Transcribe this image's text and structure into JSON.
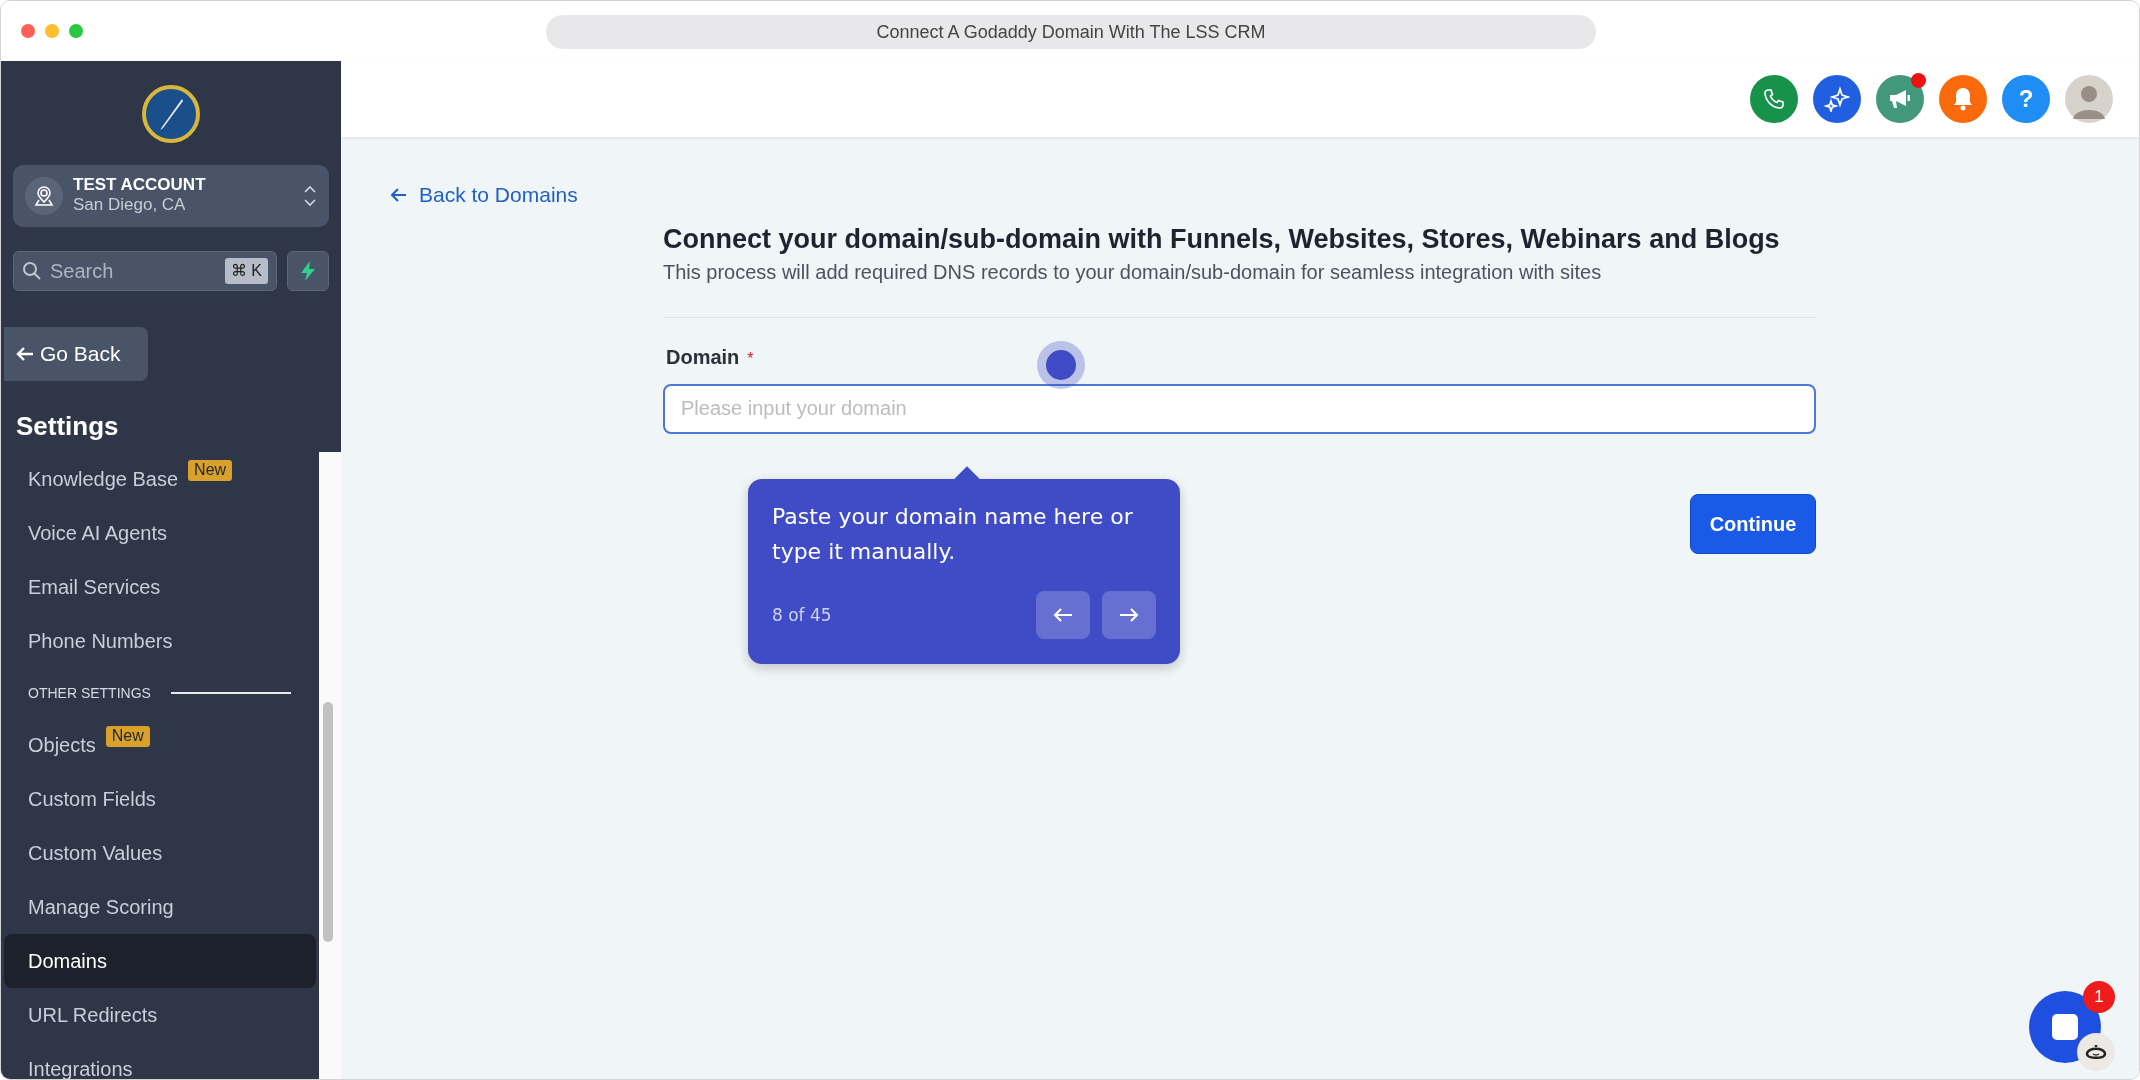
{
  "window": {
    "title": "Connect A Godaddy Domain With The LSS CRM"
  },
  "account": {
    "name": "TEST ACCOUNT",
    "location": "San Diego, CA"
  },
  "search": {
    "placeholder": "Search",
    "shortcut": "⌘ K"
  },
  "go_back": "Go Back",
  "sidebar": {
    "title": "Settings",
    "items": [
      {
        "kind": "item",
        "label": "Knowledge Base",
        "badge": "New",
        "selected": false
      },
      {
        "kind": "item",
        "label": "Voice AI Agents",
        "selected": false
      },
      {
        "kind": "item",
        "label": "Email Services",
        "selected": false
      },
      {
        "kind": "item",
        "label": "Phone Numbers",
        "selected": false
      },
      {
        "kind": "section",
        "label": "OTHER SETTINGS"
      },
      {
        "kind": "item",
        "label": "Objects",
        "badge": "New",
        "selected": false
      },
      {
        "kind": "item",
        "label": "Custom Fields",
        "selected": false
      },
      {
        "kind": "item",
        "label": "Custom Values",
        "selected": false
      },
      {
        "kind": "item",
        "label": "Manage Scoring",
        "selected": false
      },
      {
        "kind": "item",
        "label": "Domains",
        "selected": true
      },
      {
        "kind": "item",
        "label": "URL Redirects",
        "selected": false
      },
      {
        "kind": "item",
        "label": "Integrations",
        "selected": false
      }
    ]
  },
  "header": {
    "buttons": [
      {
        "kind": "phone",
        "color": "#16924a"
      },
      {
        "kind": "sparkle",
        "color": "#1f5fe0"
      },
      {
        "kind": "megaphone",
        "color": "#43977a",
        "dot": true
      },
      {
        "kind": "bell",
        "color": "#f86a0c"
      },
      {
        "kind": "help",
        "color": "#1e8ef5",
        "text": "?"
      },
      {
        "kind": "avatar",
        "color": "#d8d2cc"
      }
    ]
  },
  "main": {
    "back_link": "Back to Domains",
    "title": "Connect your domain/sub-domain with Funnels, Websites, Stores, Webinars and Blogs",
    "subtitle": "This process will add required DNS records to your domain/sub-domain for seamless integration with sites",
    "field": {
      "label": "Domain",
      "required_mark": "*",
      "placeholder": "Please input your domain"
    },
    "continue": "Continue"
  },
  "tour": {
    "text": "Paste your domain name here or type it manually.",
    "step": "8 of 45"
  },
  "chat": {
    "badge": "1"
  }
}
